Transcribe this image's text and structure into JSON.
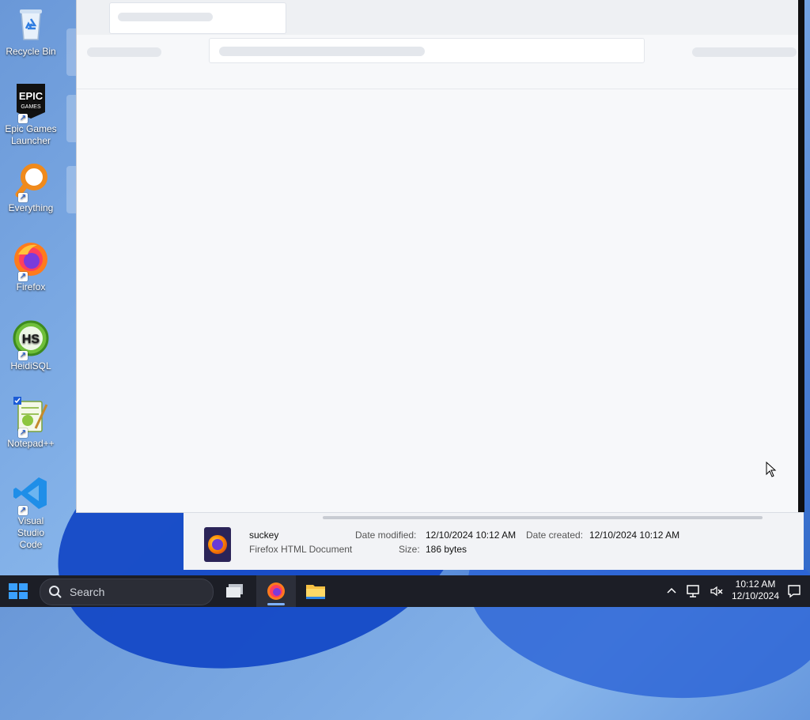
{
  "desktop": {
    "icons": [
      {
        "label": "Recycle Bin"
      },
      {
        "label": "Epic Games Launcher"
      },
      {
        "label": "Everything"
      },
      {
        "label": "Firefox"
      },
      {
        "label": "HeidiSQL"
      },
      {
        "label": "Notepad++"
      },
      {
        "label": "Visual Studio Code"
      }
    ]
  },
  "details_pane": {
    "file_name": "suckey",
    "file_type": "Firefox HTML Document",
    "date_modified_label": "Date modified:",
    "date_modified_value": "12/10/2024 10:12 AM",
    "date_created_label": "Date created:",
    "date_created_value": "12/10/2024 10:12 AM",
    "size_label": "Size:",
    "size_value": "186 bytes"
  },
  "taskbar": {
    "search_placeholder": "Search",
    "time": "10:12 AM",
    "date": "12/10/2024",
    "apps": [
      "task-view-icon",
      "firefox-icon",
      "file-explorer-icon"
    ]
  }
}
